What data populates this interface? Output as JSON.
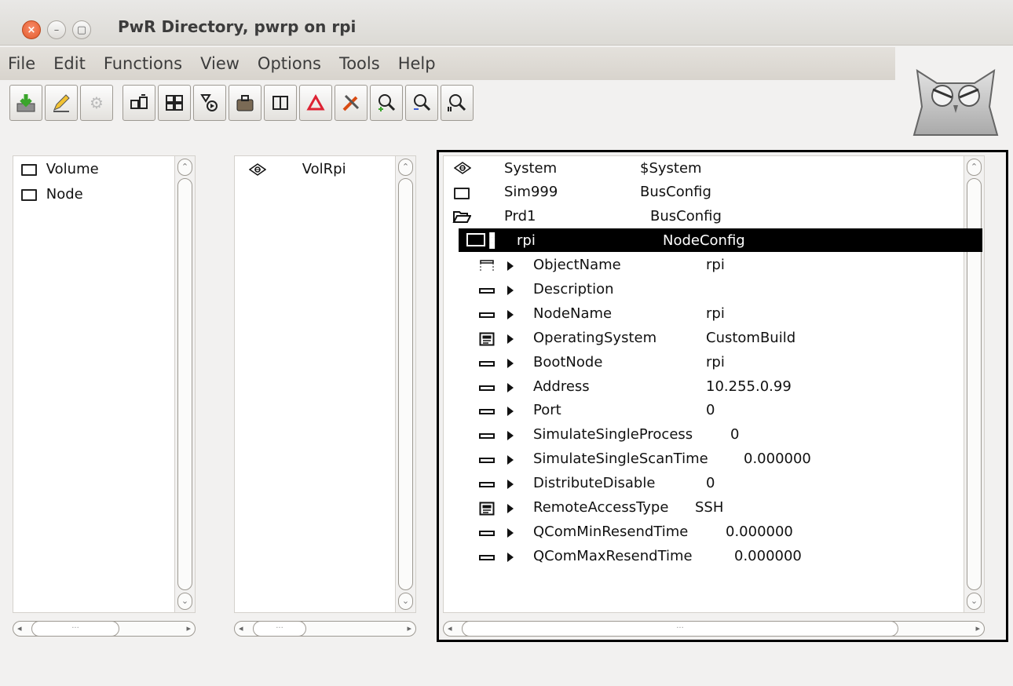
{
  "window": {
    "title": "PwR Directory,  pwrp on rpi"
  },
  "menu": [
    "File",
    "Edit",
    "Functions",
    "View",
    "Options",
    "Tools",
    "Help"
  ],
  "toolbar": [
    {
      "icon": "save-icon",
      "glyph": "💾"
    },
    {
      "icon": "edit-pencil-icon",
      "glyph": "✎"
    },
    {
      "icon": "gears-icon",
      "glyph": "⚙"
    },
    {
      "icon": "configure-icon",
      "glyph": "⧉"
    },
    {
      "icon": "hierarchy-icon",
      "glyph": "⊞"
    },
    {
      "icon": "filter-icon",
      "glyph": "⧖"
    },
    {
      "icon": "package-icon",
      "glyph": "⛁"
    },
    {
      "icon": "split-view-icon",
      "glyph": "◫"
    },
    {
      "icon": "warning-triangle-icon",
      "glyph": "△"
    },
    {
      "icon": "tools-icon",
      "glyph": "✂"
    },
    {
      "icon": "zoom-in-icon",
      "glyph": "🔍"
    },
    {
      "icon": "zoom-out-icon",
      "glyph": "🔎"
    },
    {
      "icon": "zoom-reset-icon",
      "glyph": "⌕"
    }
  ],
  "pane1": {
    "items": [
      "Volume",
      "Node"
    ]
  },
  "pane2": {
    "items": [
      "VolRpi"
    ]
  },
  "pane3": {
    "tree": [
      {
        "name": "System",
        "class": "$System"
      },
      {
        "name": "Sim999",
        "class": "BusConfig"
      },
      {
        "name": "Prd1",
        "class": "BusConfig"
      }
    ],
    "selected": {
      "name": "rpi",
      "class": "NodeConfig"
    },
    "attributes": [
      {
        "name": "ObjectName",
        "value": "rpi"
      },
      {
        "name": "Description",
        "value": ""
      },
      {
        "name": "NodeName",
        "value": "rpi"
      },
      {
        "name": "OperatingSystem",
        "value": "CustomBuild"
      },
      {
        "name": "BootNode",
        "value": "rpi"
      },
      {
        "name": "Address",
        "value": "10.255.0.99"
      },
      {
        "name": "Port",
        "value": "0"
      },
      {
        "name": "SimulateSingleProcess",
        "value": "0"
      },
      {
        "name": "SimulateSingleScanTime",
        "value": "0.000000"
      },
      {
        "name": "DistributeDisable",
        "value": "0"
      },
      {
        "name": "RemoteAccessType",
        "value": "SSH"
      },
      {
        "name": "QComMinResendTime",
        "value": "0.000000"
      },
      {
        "name": "QComMaxResendTime",
        "value": "0.000000"
      }
    ]
  }
}
